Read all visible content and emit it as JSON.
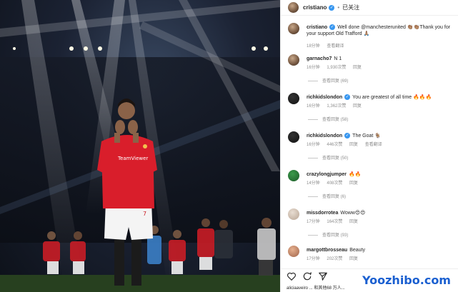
{
  "header": {
    "username": "cristiano",
    "separator": "•",
    "follow_label": "已关注"
  },
  "comments": [
    {
      "user": "cristiano",
      "verified": true,
      "text": "Well done @manchesterunited 👏🏽👏🏽Thank you for your support Old Trafford 🙏🏽",
      "time": "18分钟",
      "likes": "",
      "reply": "",
      "translate": "查看翻译",
      "view_replies": ""
    },
    {
      "user": "garnacho7",
      "verified": false,
      "text": "N 1",
      "time": "16分钟",
      "likes": "1,930次赞",
      "reply": "回复",
      "translate": "",
      "view_replies": "查看回复 (69)"
    },
    {
      "user": "richkidslondon",
      "verified": true,
      "text": "You are greatest of all time 🔥🔥🔥",
      "time": "16分钟",
      "likes": "1,362次赞",
      "reply": "回复",
      "translate": "",
      "view_replies": "查看回复 (58)"
    },
    {
      "user": "richkidslondon",
      "verified": true,
      "text": "The Goat 🐐",
      "time": "16分钟",
      "likes": "446次赞",
      "reply": "回复",
      "translate": "查看翻译",
      "view_replies": "查看回复 (50)"
    },
    {
      "user": "crazylongjumper",
      "verified": false,
      "text": "🔥🔥",
      "time": "14分钟",
      "likes": "408次赞",
      "reply": "回复",
      "translate": "",
      "view_replies": "查看回复 (6)"
    },
    {
      "user": "missdorrotea",
      "verified": false,
      "text": "Woww😍😍",
      "time": "17分钟",
      "likes": "164次赞",
      "reply": "回复",
      "translate": "",
      "view_replies": "查看回复 (93)"
    },
    {
      "user": "margottbrosseau",
      "verified": false,
      "text": "Beauty",
      "time": "17分钟",
      "likes": "202次赞",
      "reply": "回复",
      "translate": "",
      "view_replies": ""
    }
  ],
  "bottom_text": "aliciaaveiro ... 和其他68 万人...",
  "watermark": "Yoozhibo.com",
  "colors": {
    "verified": "#3897f0",
    "jersey": "#d91e2b",
    "watermark": "#1a5fd0"
  },
  "icons": [
    "heart-icon",
    "comment-icon",
    "share-icon"
  ]
}
